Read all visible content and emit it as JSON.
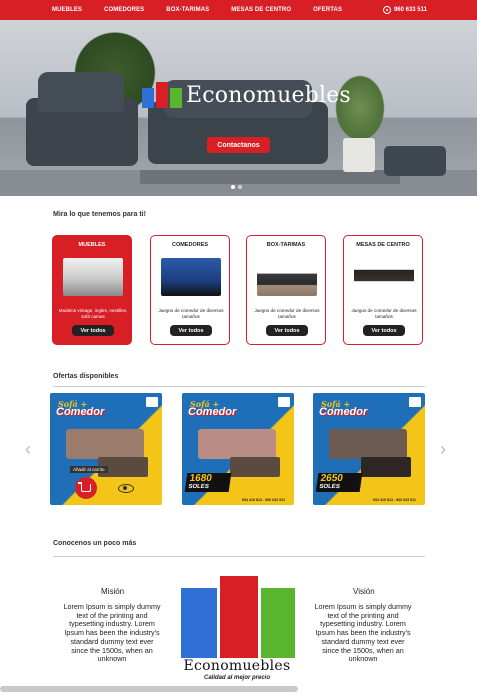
{
  "nav": {
    "items": [
      "MUEBLES",
      "COMEDORES",
      "BOX-TARIMAS",
      "MESAS DE CENTRO",
      "OFERTAS"
    ],
    "phone": "960 633 511",
    "phone_icon": "whatsapp-icon"
  },
  "hero": {
    "brand": "Economuebles",
    "button": "Contactanos",
    "slides": 2,
    "active_slide": 1
  },
  "categories": {
    "title": "Mira lo que tenemos para ti!",
    "items": [
      {
        "title": "MUEBLES",
        "desc": "Modelos vintage, ingles, nestilles, sofá camas",
        "button": "Ver todos",
        "active": true
      },
      {
        "title": "COMEDORES",
        "desc": "Juegos de comedor de diversos tamaños",
        "button": "Ver todos",
        "active": false
      },
      {
        "title": "BOX-TARIMAS",
        "desc": "Juegos de comedor de diversos tamaños",
        "button": "Ver todos",
        "active": false
      },
      {
        "title": "MESAS DE CENTRO",
        "desc": "Juegos de comedor de diversos tamaños",
        "button": "Ver todos",
        "active": false
      }
    ]
  },
  "offers": {
    "title": "Ofertas disponibles",
    "items": [
      {
        "line1": "Sofá +",
        "line2": "Comedor",
        "price": "",
        "soles": "",
        "contact": "",
        "hover_label": "Añadir al carrito"
      },
      {
        "line1": "Sofá +",
        "line2": "Comedor",
        "price": "1680",
        "soles": "SOLES",
        "contact": "934 419 813 - 960 633 511"
      },
      {
        "line1": "Sofá +",
        "line2": "Comedor",
        "price": "2650",
        "soles": "SOLES",
        "contact": "934 419 813 - 960 633 511"
      }
    ],
    "cart_icon": "cart-icon",
    "eye_icon": "eye-icon",
    "prev_icon": "chevron-left-icon",
    "next_icon": "chevron-right-icon"
  },
  "about": {
    "title": "Conocenos un poco más",
    "mision_title": "Misión",
    "mision_text": "Lorem Ipsum is simply dummy text of the printing and typesetting industry. Lorem Ipsum has been the industry's standard dummy text ever since the 1500s, when an unknown",
    "vision_title": "Visión",
    "vision_text": "Lorem Ipsum is simply dummy text of the printing and typesetting industry. Lorem Ipsum has been the industry's standard dummy text ever since the 1500s, when an unknown",
    "logo_word": "Economuebles",
    "logo_slogan": "Calidad al mejor precio"
  },
  "colors": {
    "brand_red": "#d81f26",
    "brand_blue": "#2f6fd6",
    "brand_green": "#5ab52e",
    "offer_yellow": "#f2c518"
  }
}
